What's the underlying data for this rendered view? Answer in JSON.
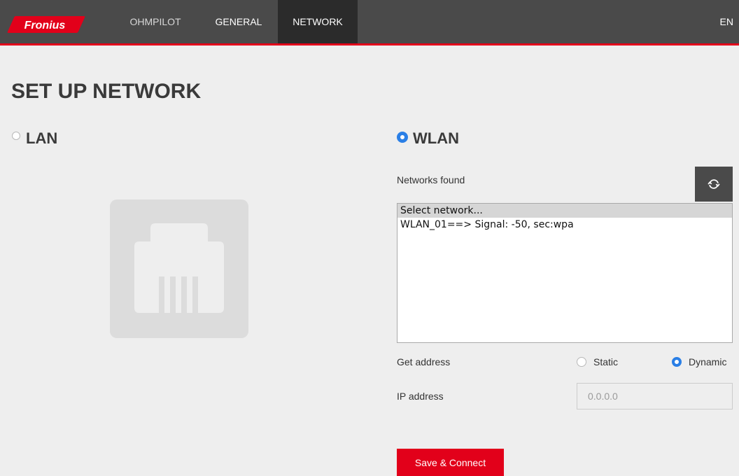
{
  "brand": {
    "logo_text": "Fronius",
    "accent_color": "#e2001a"
  },
  "nav": {
    "items": [
      {
        "label": "OHMPILOT",
        "active": false
      },
      {
        "label": "GENERAL",
        "active": false
      },
      {
        "label": "NETWORK",
        "active": true
      }
    ],
    "language": "EN"
  },
  "page": {
    "title": "SET UP NETWORK"
  },
  "lan": {
    "label": "LAN",
    "selected": false,
    "icon": "ethernet-port-icon"
  },
  "wlan": {
    "label": "WLAN",
    "selected": true,
    "networks_found_label": "Networks found",
    "refresh_icon": "refresh-icon",
    "networks": [
      "Select network...",
      "WLAN_01==> Signal: -50, sec:wpa"
    ],
    "selected_network_index": 0,
    "get_address_label": "Get address",
    "address_options": [
      {
        "label": "Static",
        "selected": false
      },
      {
        "label": "Dynamic",
        "selected": true
      }
    ],
    "ip_address_label": "IP address",
    "ip_address_placeholder": "0.0.0.0",
    "ip_address_value": ""
  },
  "actions": {
    "save_label": "Save & Connect"
  }
}
